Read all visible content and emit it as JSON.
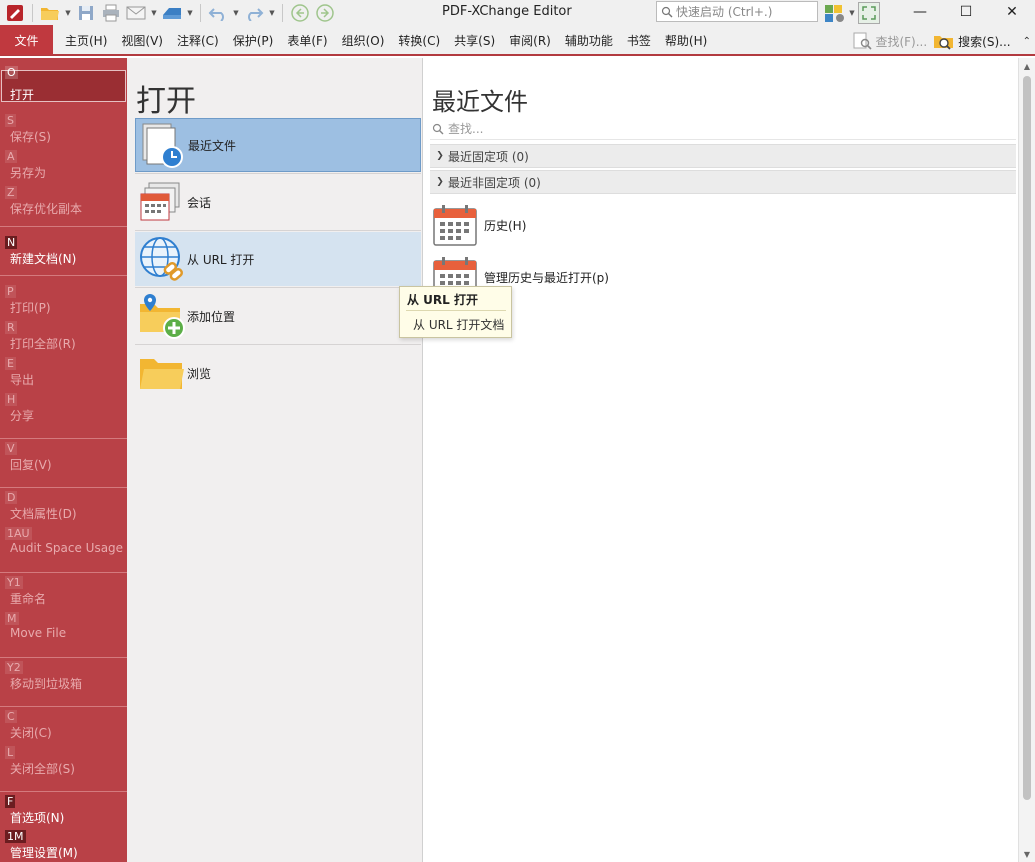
{
  "window": {
    "title": "PDF-XChange Editor",
    "quick_launch_placeholder": "快速启动 (Ctrl+.)",
    "minimize": "—",
    "maximize": "☐",
    "close": "✕"
  },
  "menu": {
    "file_tab": "文件",
    "items": [
      "主页(H)",
      "视图(V)",
      "注释(C)",
      "保护(P)",
      "表单(F)",
      "组织(O)",
      "转换(C)",
      "共享(S)",
      "审阅(R)",
      "辅助功能",
      "书签",
      "帮助(H)"
    ],
    "find": "查找(F)...",
    "search": "搜索(S)..."
  },
  "leftnav": {
    "items": [
      {
        "key": "O",
        "label": "打开"
      },
      {
        "key": "S",
        "label": "保存(S)"
      },
      {
        "key": "A",
        "label": "另存为"
      },
      {
        "key": "Z",
        "label": "保存优化副本"
      },
      {
        "key": "N",
        "label": "新建文档(N)"
      },
      {
        "key": "P",
        "label": "打印(P)"
      },
      {
        "key": "R",
        "label": "打印全部(R)"
      },
      {
        "key": "E",
        "label": "导出"
      },
      {
        "key": "H",
        "label": "分享"
      },
      {
        "key": "V",
        "label": "回复(V)"
      },
      {
        "key": "D",
        "label": "文档属性(D)"
      },
      {
        "key": "1AU",
        "label": "Audit Space Usage"
      },
      {
        "key": "Y1",
        "label": "重命名"
      },
      {
        "key": "M",
        "label": "Move File"
      },
      {
        "key": "Y2",
        "label": "移动到垃圾箱"
      },
      {
        "key": "C",
        "label": "关闭(C)"
      },
      {
        "key": "L",
        "label": "关闭全部(S)"
      },
      {
        "key": "F",
        "label": "首选项(N)"
      },
      {
        "key": "1M",
        "label": "管理设置(M)"
      }
    ]
  },
  "open_panel": {
    "title": "打开",
    "items": [
      {
        "label": "最近文件",
        "icon": "recent-files-icon"
      },
      {
        "label": "会话",
        "icon": "sessions-icon"
      },
      {
        "label": "从 URL 打开",
        "icon": "globe-link-icon"
      },
      {
        "label": "添加位置",
        "icon": "add-location-folder-icon"
      },
      {
        "label": "浏览",
        "icon": "folder-icon"
      }
    ]
  },
  "recent_panel": {
    "title": "最近文件",
    "search_placeholder": "查找...",
    "groups": [
      "最近固定项 (0)",
      "最近非固定项 (0)"
    ],
    "items": [
      "历史(H)",
      "管理历史与最近打开(p)"
    ]
  },
  "tooltip": {
    "title": "从 URL 打开",
    "body": "从 URL 打开文档"
  },
  "colors": {
    "accent_red": "#c0393f",
    "nav_red": "#b94147",
    "selected_blue": "#9dbfe2"
  }
}
